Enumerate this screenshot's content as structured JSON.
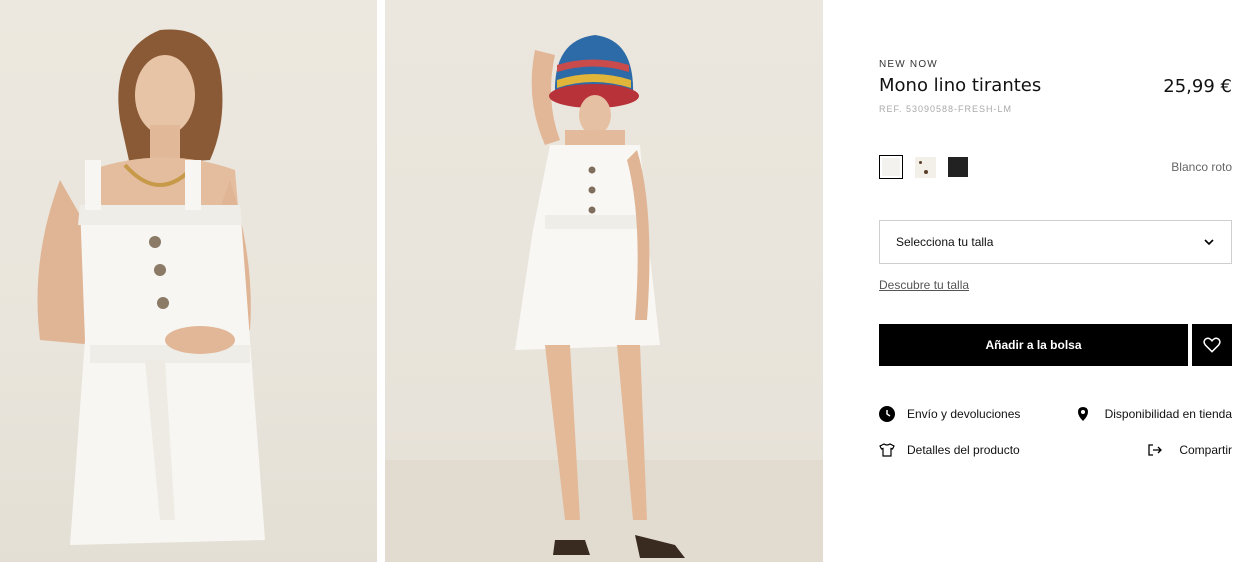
{
  "gallery": {
    "images": [
      {
        "alt": "Mono lino tirantes - front view"
      },
      {
        "alt": "Mono lino tirantes - full length with bucket hat"
      }
    ]
  },
  "product": {
    "eyebrow": "NEW NOW",
    "name": "Mono lino tirantes",
    "price": "25,99 €",
    "reference": "REF. 53090588-FRESH-LM",
    "selected_color": "Blanco roto",
    "colors": [
      {
        "name": "Blanco roto",
        "hex": "#f4f2ee",
        "selected": true
      },
      {
        "name": "Estampado",
        "hex": "#f3f0ea",
        "selected": false
      },
      {
        "name": "Negro",
        "hex": "#222222",
        "selected": false
      }
    ]
  },
  "size": {
    "placeholder": "Selecciona tu talla",
    "guide_link": "Descubre tu talla"
  },
  "actions": {
    "add_to_bag": "Añadir a la bolsa",
    "favorite_icon": "heart-icon"
  },
  "info_links": {
    "shipping": "Envío y devoluciones",
    "store_availability": "Disponibilidad en tienda",
    "details": "Detalles del producto",
    "share": "Compartir"
  },
  "colors": {
    "accent": "#000000",
    "background": "#ffffff",
    "muted_text": "#a9a9a9"
  }
}
